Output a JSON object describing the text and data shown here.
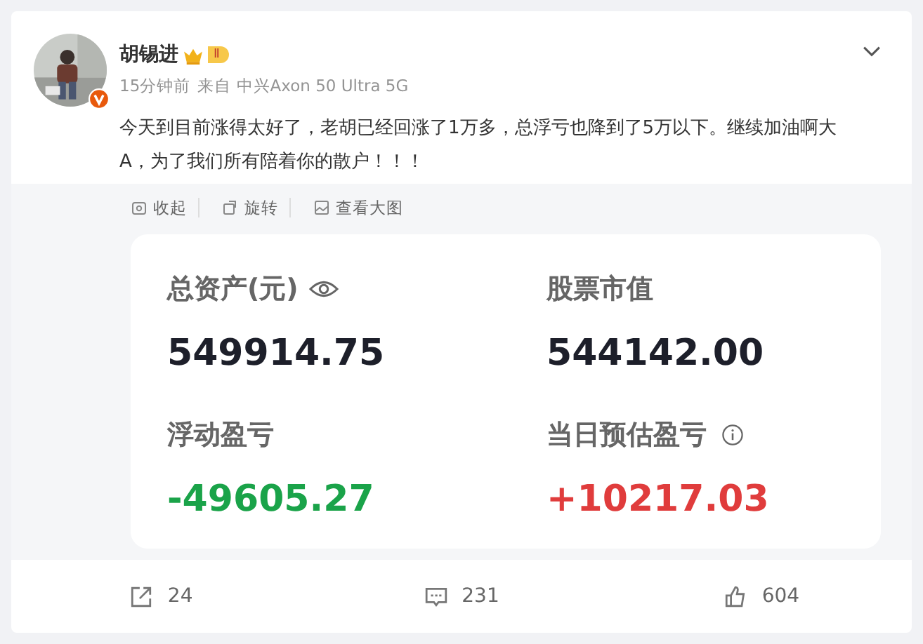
{
  "post": {
    "author": "胡锡进",
    "badge": "Ⅱ",
    "verified": true,
    "time": "15分钟前",
    "source": "来自 中兴Axon 50 Ultra 5G",
    "text": "今天到目前涨得太好了，老胡已经回涨了1万多，总浮亏也降到了5万以下。继续加油啊大A，为了我们所有陪着你的散户！！！"
  },
  "image_tools": [
    {
      "kind": "collapse",
      "label": "收起"
    },
    {
      "kind": "rotate",
      "label": "旋转"
    },
    {
      "kind": "view",
      "label": "查看大图"
    }
  ],
  "stats": [
    {
      "label": "总资产(元)",
      "kind": "eye",
      "value": "549914.75",
      "color": "#1d1f2a"
    },
    {
      "label": "股票市值",
      "kind": "plain",
      "value": "544142.00",
      "color": "#1d1f2a"
    },
    {
      "label": "浮动盈亏",
      "kind": "plain",
      "value": "-49605.27",
      "color": "#1aa349"
    },
    {
      "label": "当日预估盈亏",
      "kind": "info",
      "value": "+10217.03",
      "color": "#e03c3c"
    }
  ],
  "actions": [
    {
      "kind": "repost",
      "count": "24"
    },
    {
      "kind": "comment",
      "count": "231"
    },
    {
      "kind": "like",
      "count": "604"
    }
  ]
}
